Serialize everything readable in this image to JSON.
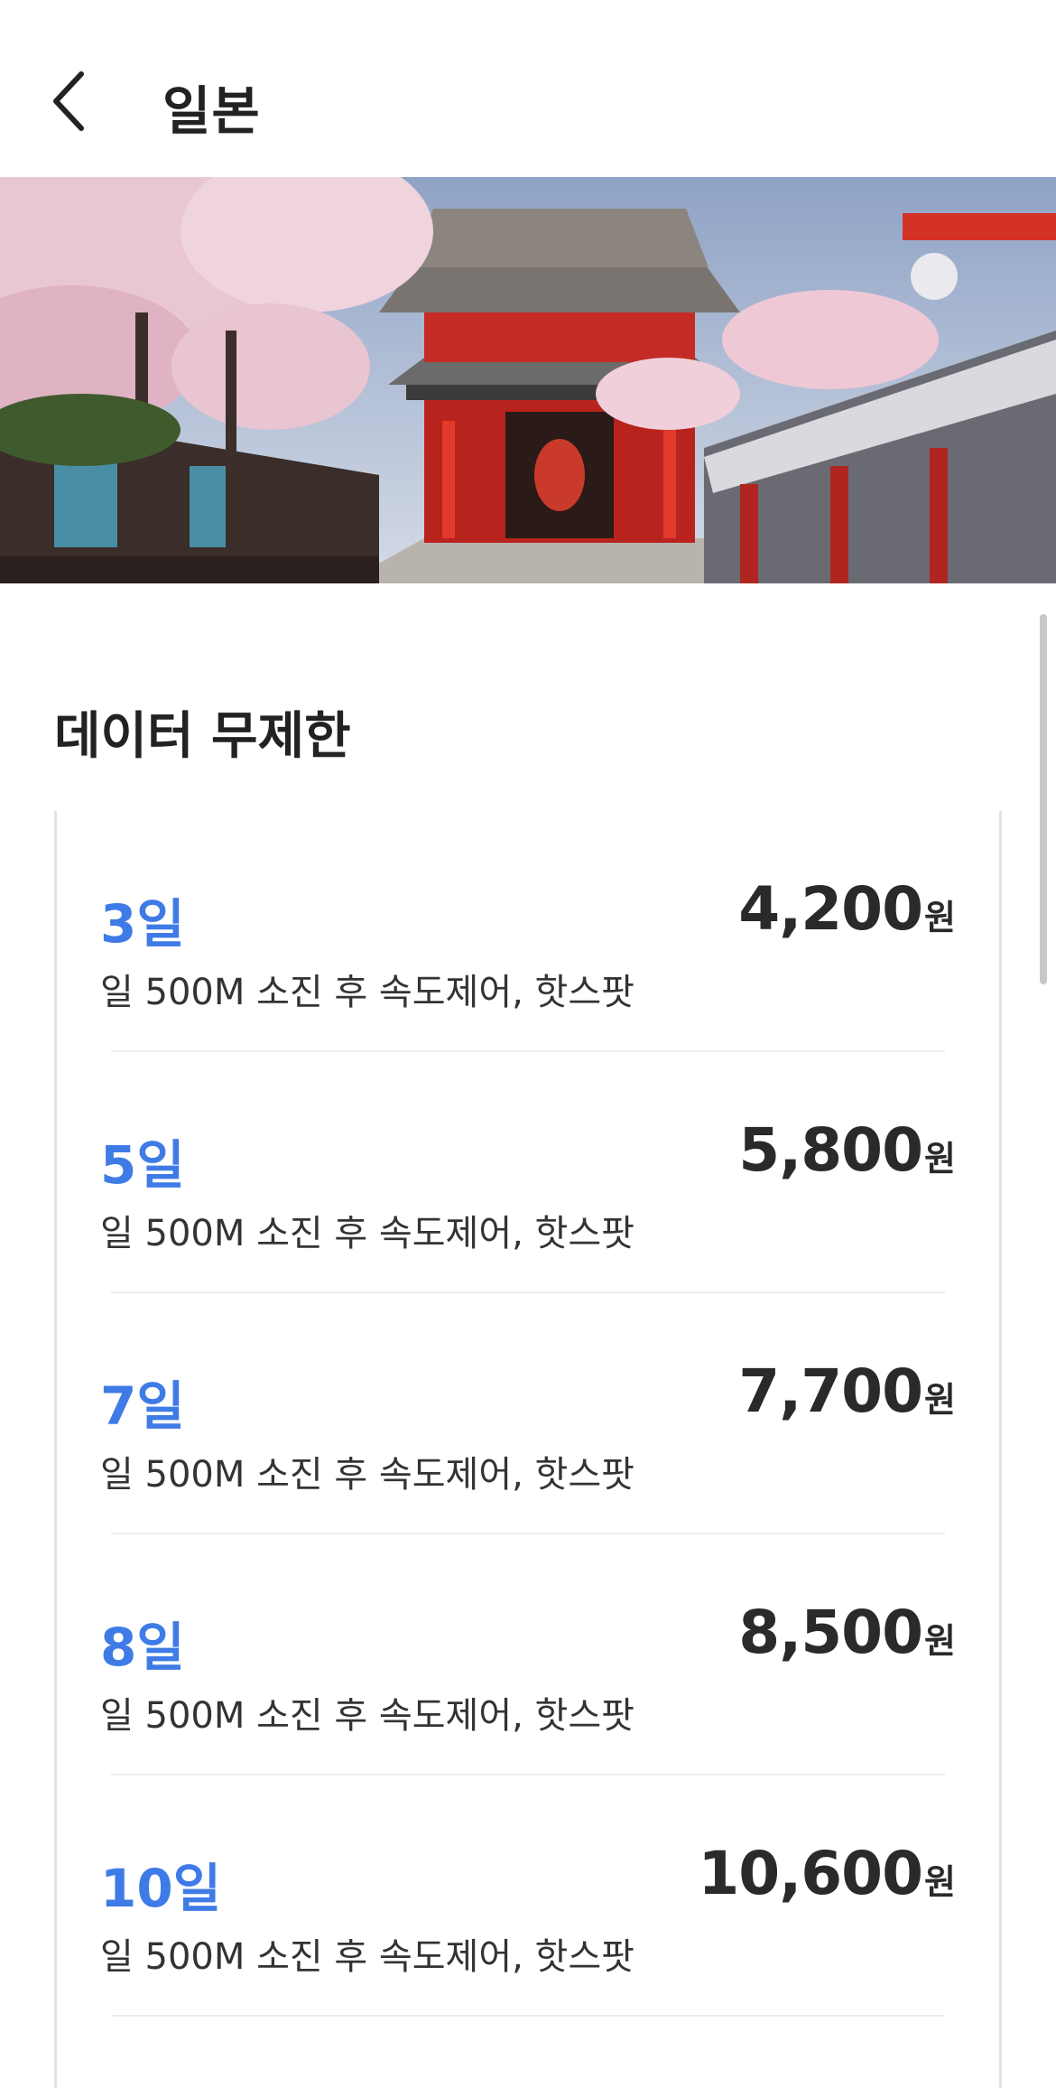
{
  "header": {
    "title": "일본",
    "back_icon": "chevron-left-icon"
  },
  "section": {
    "title": "데이터 무제한"
  },
  "plans": [
    {
      "days": "3일",
      "desc": "일 500M 소진 후 속도제어, 핫스팟",
      "price": "4,200",
      "unit": "원"
    },
    {
      "days": "5일",
      "desc": "일 500M 소진 후 속도제어, 핫스팟",
      "price": "5,800",
      "unit": "원"
    },
    {
      "days": "7일",
      "desc": "일 500M 소진 후 속도제어, 핫스팟",
      "price": "7,700",
      "unit": "원"
    },
    {
      "days": "8일",
      "desc": "일 500M 소진 후 속도제어, 핫스팟",
      "price": "8,500",
      "unit": "원"
    },
    {
      "days": "10일",
      "desc": "일 500M 소진 후 속도제어, 핫스팟",
      "price": "10,600",
      "unit": "원"
    }
  ],
  "colors": {
    "accent": "#3f7be6",
    "text": "#222222",
    "divider": "#ececec"
  }
}
